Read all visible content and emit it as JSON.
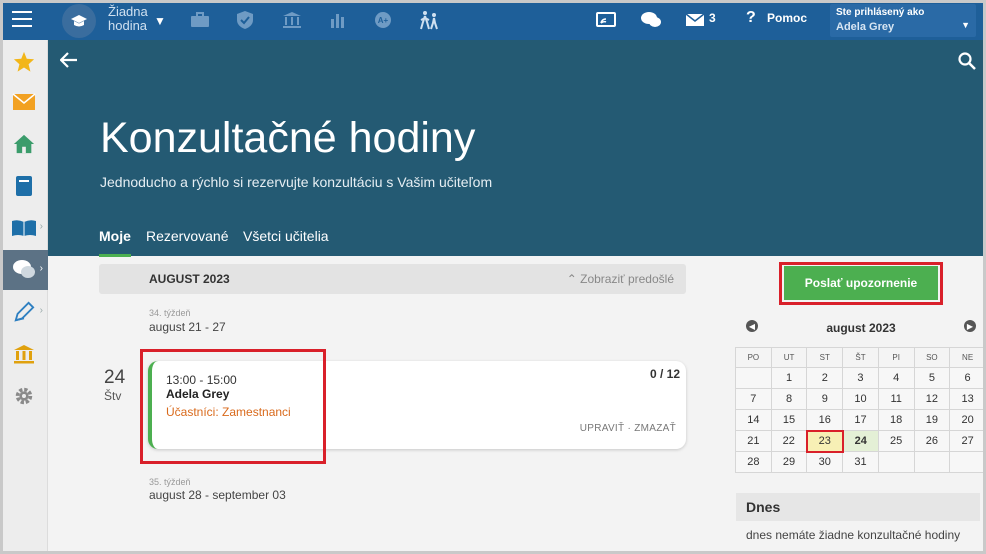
{
  "topbar": {
    "brand_line1": "Žiadna",
    "brand_line2": "hodina",
    "messages_count": "3",
    "help_label": "Pomoc",
    "user_caption": "Ste prihlásený ako",
    "user_name": "Adela Grey"
  },
  "sidebar": {
    "items": [
      "star-icon",
      "mail-icon",
      "home-icon",
      "notebook-icon",
      "book-icon",
      "chat-icon",
      "pencil-icon",
      "bank-icon",
      "gear-icon"
    ],
    "active": "chat-icon"
  },
  "header": {
    "title": "Konzultačné hodiny",
    "subtitle": "Jednoducho a rýchlo si rezervujte konzultáciu s Vašim učiteľom",
    "tabs": [
      {
        "label": "Moje",
        "active": true
      },
      {
        "label": "Rezervované",
        "active": false
      },
      {
        "label": "Všetci učitelia",
        "active": false
      }
    ]
  },
  "main": {
    "month_label": "AUGUST 2023",
    "show_previous": "Zobraziť predošlé",
    "week1_label": "34. týždeň",
    "week1_range": "august 21 - 27",
    "day_num": "24",
    "day_name": "Štv",
    "event": {
      "time": "13:00 - 15:00",
      "teacher": "Adela Grey",
      "participants": "Účastníci: Zamestnanci",
      "count": "0 / 12",
      "actions": "UPRAVIŤ · ZMAZAŤ"
    },
    "week2_label": "35. týždeň",
    "week2_range": "august 28 - september 03"
  },
  "right": {
    "send_button": "Poslať upozornenie",
    "calendar_title": "august 2023",
    "weekdays": [
      "PO",
      "UT",
      "ST",
      "ŠT",
      "PI",
      "SO",
      "NE"
    ],
    "weeks": [
      [
        "",
        "1",
        "2",
        "3",
        "4",
        "5",
        "6"
      ],
      [
        "7",
        "8",
        "9",
        "10",
        "11",
        "12",
        "13"
      ],
      [
        "14",
        "15",
        "16",
        "17",
        "18",
        "19",
        "20"
      ],
      [
        "21",
        "22",
        "23",
        "24",
        "25",
        "26",
        "27"
      ],
      [
        "28",
        "29",
        "30",
        "31",
        "",
        "",
        ""
      ]
    ],
    "today": "23",
    "selected": "24",
    "today_heading": "Dnes",
    "today_text": "dnes nemáte žiadne konzultačné hodiny"
  },
  "colors": {
    "topbar": "#1e5f99",
    "hero": "#245a73",
    "accent_green": "#4caf50",
    "highlight_red": "#d9202a",
    "participants_orange": "#d96a1c"
  }
}
